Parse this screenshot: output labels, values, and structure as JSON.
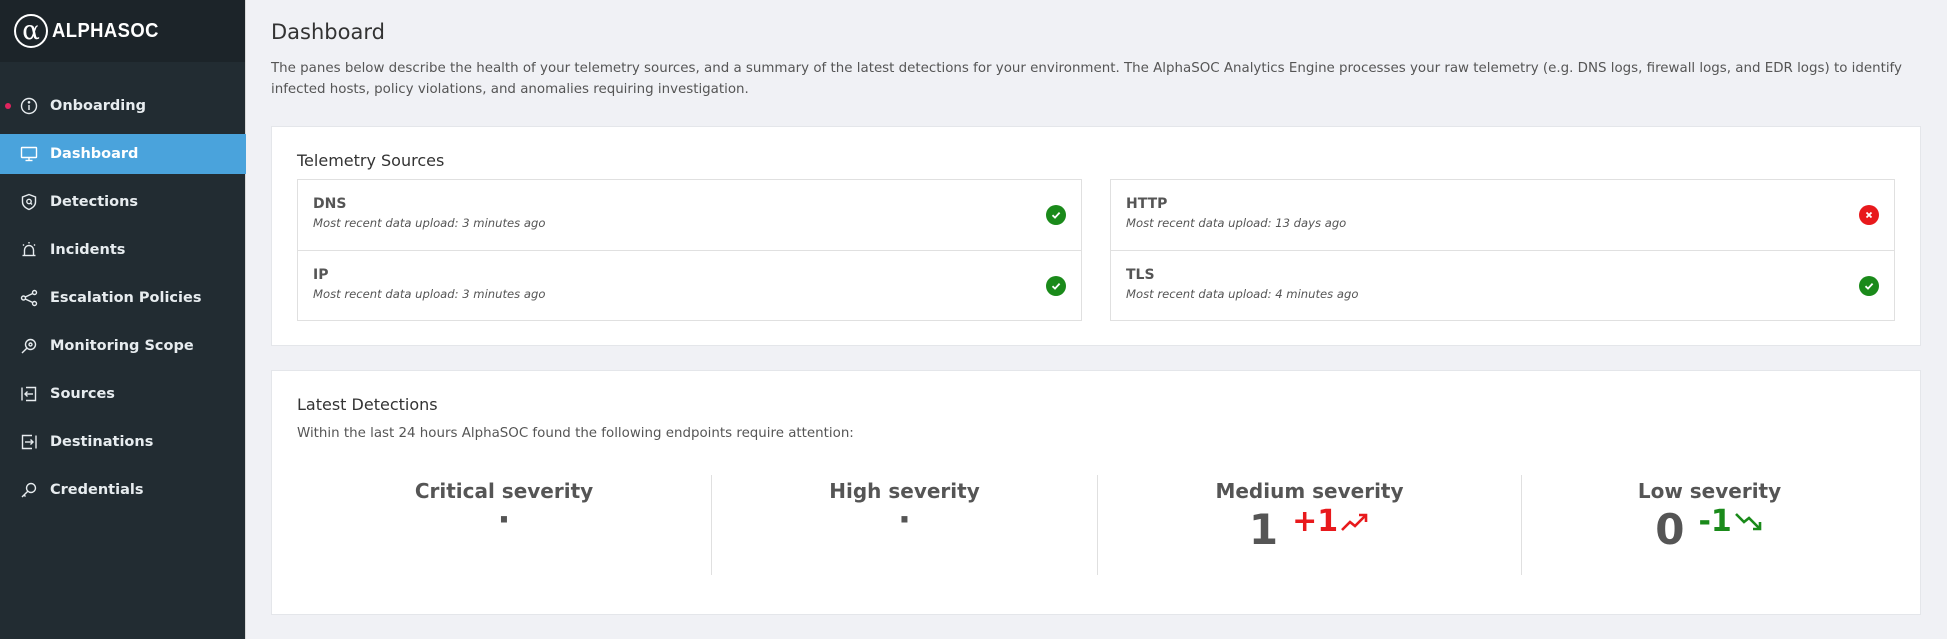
{
  "brand": {
    "symbol": "α",
    "name": "ALPHASOC"
  },
  "nav": {
    "items": [
      {
        "label": "Onboarding",
        "icon": "info-icon",
        "alert": true
      },
      {
        "label": "Dashboard",
        "icon": "monitor-icon",
        "active": true
      },
      {
        "label": "Detections",
        "icon": "shield-icon"
      },
      {
        "label": "Incidents",
        "icon": "alarm-icon"
      },
      {
        "label": "Escalation Policies",
        "icon": "share-icon"
      },
      {
        "label": "Monitoring Scope",
        "icon": "scope-icon"
      },
      {
        "label": "Sources",
        "icon": "import-icon"
      },
      {
        "label": "Destinations",
        "icon": "export-icon"
      },
      {
        "label": "Credentials",
        "icon": "key-icon"
      }
    ]
  },
  "page": {
    "title": "Dashboard",
    "description": "The panes below describe the health of your telemetry sources, and a summary of the latest detections for your environment. The AlphaSOC Analytics Engine processes your raw telemetry (e.g. DNS logs, firewall logs, and EDR logs) to identify infected hosts, policy violations, and anomalies requiring investigation."
  },
  "telemetry": {
    "title": "Telemetry Sources",
    "sources": [
      {
        "name": "DNS",
        "status_text": "Most recent data upload: 3 minutes ago",
        "ok": true
      },
      {
        "name": "IP",
        "status_text": "Most recent data upload: 3 minutes ago",
        "ok": true
      },
      {
        "name": "HTTP",
        "status_text": "Most recent data upload: 13 days ago",
        "ok": false
      },
      {
        "name": "TLS",
        "status_text": "Most recent data upload: 4 minutes ago",
        "ok": true
      }
    ]
  },
  "detections": {
    "title": "Latest Detections",
    "subtitle": "Within the last 24 hours AlphaSOC found the following endpoints require attention:",
    "severities": [
      {
        "label": "Critical severity",
        "value": "·",
        "delta": ""
      },
      {
        "label": "High severity",
        "value": "·",
        "delta": ""
      },
      {
        "label": "Medium severity",
        "value": "1",
        "delta": "+1",
        "trend": "up"
      },
      {
        "label": "Low severity",
        "value": "0",
        "delta": "-1",
        "trend": "down"
      }
    ]
  },
  "colors": {
    "sidebar": "#222c32",
    "active": "#4aa3dc",
    "ok": "#1a8a1a",
    "error": "#e8191c",
    "increase": "#e8191c",
    "decrease": "#1a8a1a",
    "alert_dot": "#e0245e"
  }
}
